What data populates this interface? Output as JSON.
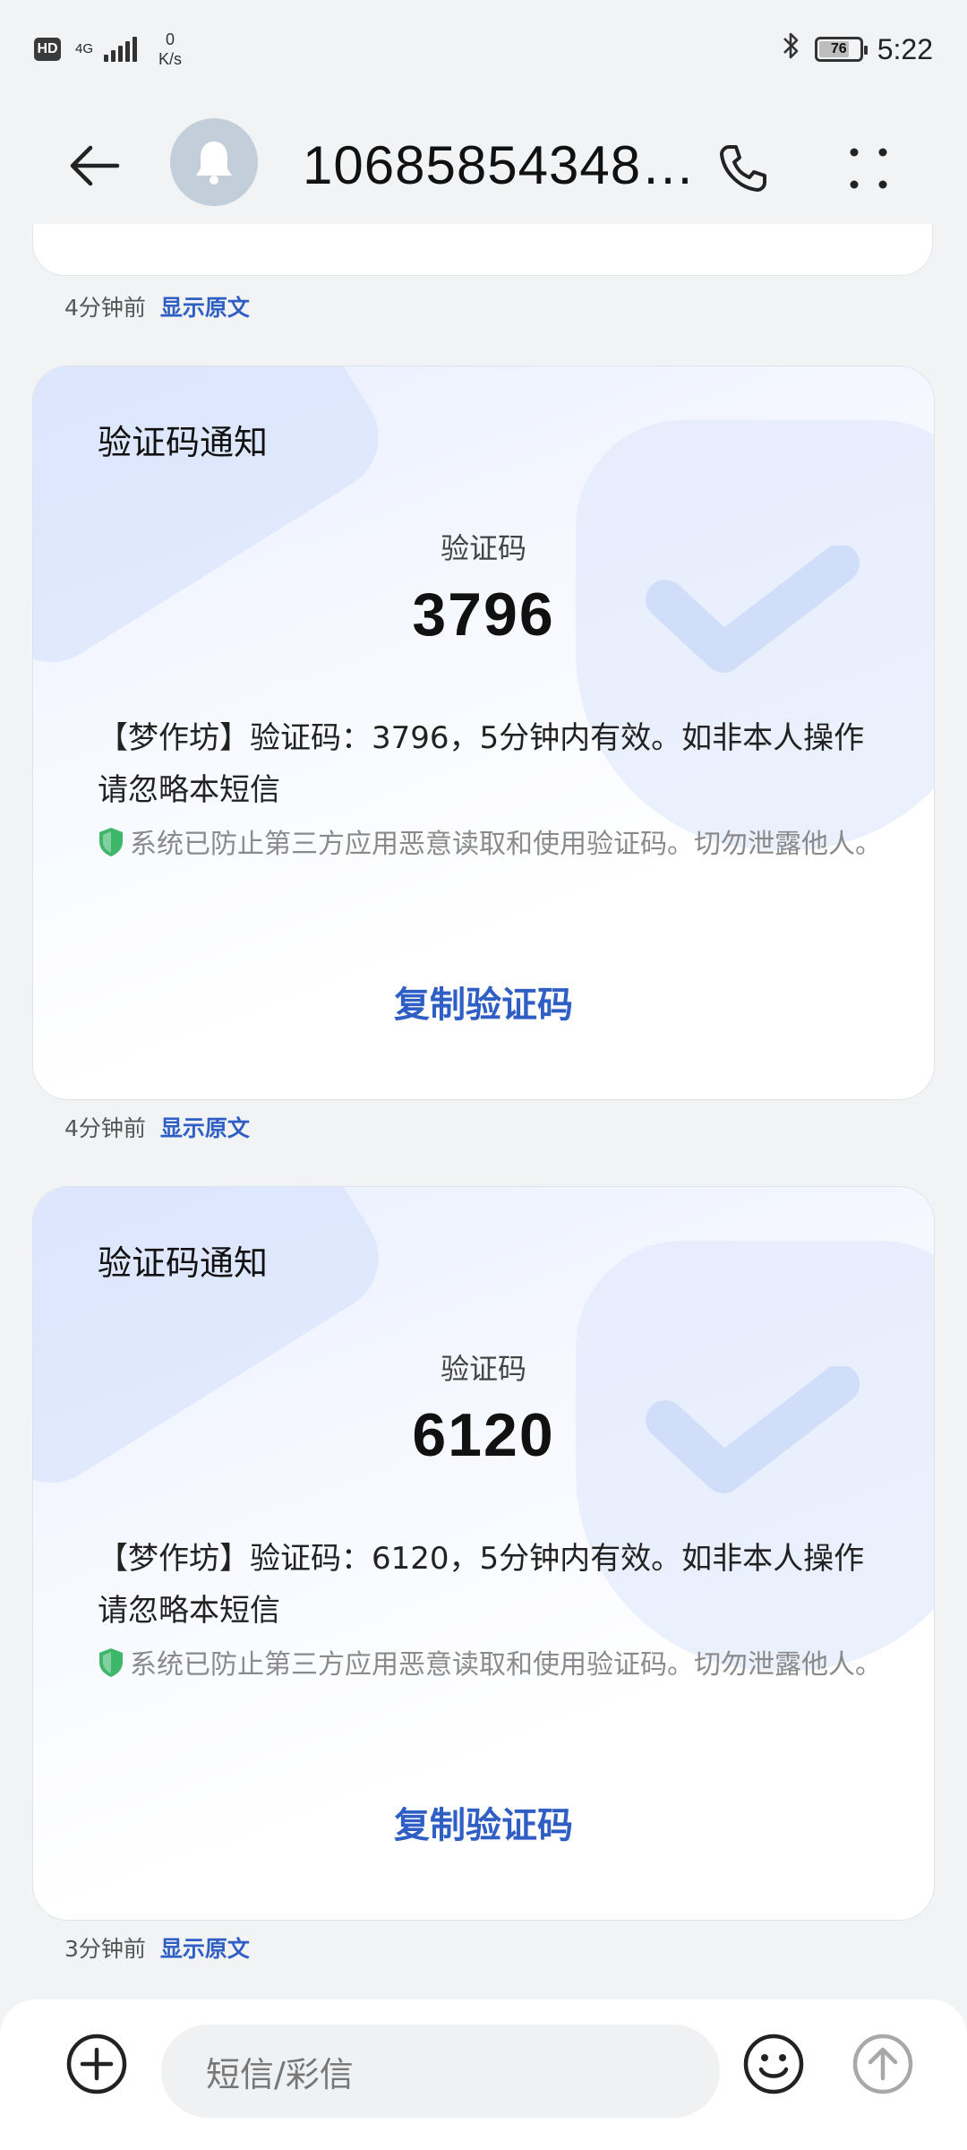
{
  "status_bar": {
    "hd_badge": "HD",
    "network_type": "4G",
    "speed_value": "0",
    "speed_unit": "K/s",
    "battery_level": "76",
    "battery_fraction": 0.76,
    "time": "5:22",
    "icons": [
      "bluetooth-icon",
      "signal-icon",
      "battery-icon"
    ]
  },
  "header": {
    "title": "10685854348…",
    "icons": [
      "back-arrow-icon",
      "bell-icon",
      "phone-icon",
      "more-icon"
    ]
  },
  "top_meta": {
    "time": "4分钟前",
    "show_original": "显示原文"
  },
  "messages": [
    {
      "title": "验证码通知",
      "code_label": "验证码",
      "code": "3796",
      "text": "【梦作坊】验证码：3796，5分钟内有效。如非本人操作请忽略本短信",
      "notice": "系统已防止第三方应用恶意读取和使用验证码。切勿泄露他人。",
      "copy_label": "复制验证码",
      "time": "4分钟前",
      "show_original": "显示原文"
    },
    {
      "title": "验证码通知",
      "code_label": "验证码",
      "code": "6120",
      "text": "【梦作坊】验证码：6120，5分钟内有效。如非本人操作请忽略本短信",
      "notice": "系统已防止第三方应用恶意读取和使用验证码。切勿泄露他人。",
      "copy_label": "复制验证码",
      "time": "3分钟前",
      "show_original": "显示原文"
    }
  ],
  "input_bar": {
    "placeholder": "短信/彩信",
    "icons": [
      "add-icon",
      "emoji-icon",
      "send-icon"
    ]
  },
  "colors": {
    "accent": "#2f5fc5",
    "background": "#f1f3f5",
    "shield_green": "#3fb76b"
  }
}
